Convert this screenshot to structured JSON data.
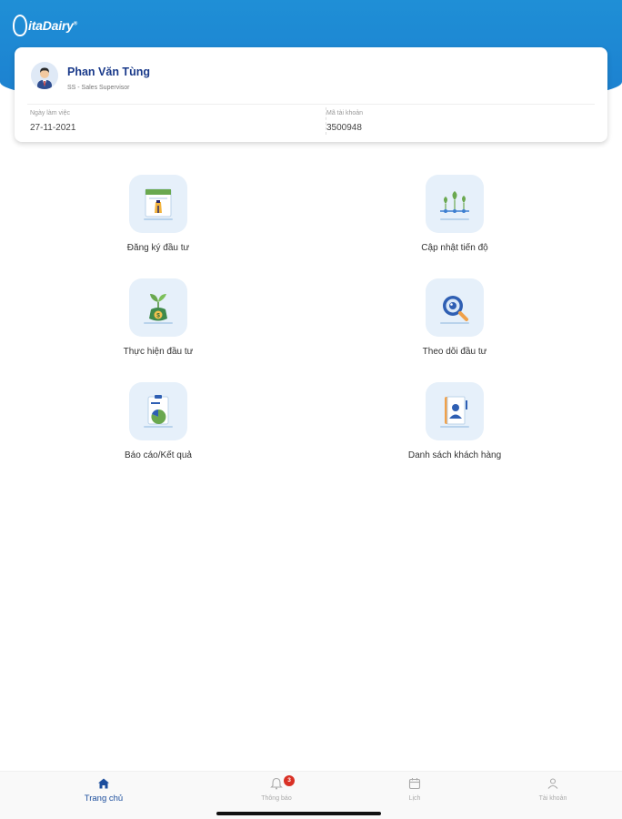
{
  "brand": {
    "logo_text": "itaDairy",
    "tm": "®",
    "primary_color": "#1f8fd6",
    "accent_color": "#1c4e9d"
  },
  "profile": {
    "name": "Phan Văn Tùng",
    "role": "SS - Sales Supervisor",
    "work_date_label": "Ngày làm việc",
    "work_date_value": "27-11-2021",
    "account_label": "Mã tài khoản",
    "account_value": "3500948"
  },
  "menu": [
    {
      "label": "Đăng ký đầu tư",
      "icon": "investment-register-icon"
    },
    {
      "label": "Cập nhật tiến độ",
      "icon": "progress-update-icon"
    },
    {
      "label": "Thực hiện đầu tư",
      "icon": "money-plant-icon"
    },
    {
      "label": "Theo dõi đầu tư",
      "icon": "magnifier-icon"
    },
    {
      "label": "Báo cáo/Kết quả",
      "icon": "report-icon"
    },
    {
      "label": "Danh sách khách hàng",
      "icon": "contact-book-icon"
    }
  ],
  "nav": [
    {
      "label": "Trang chủ",
      "icon": "home-icon",
      "active": true
    },
    {
      "label": "Thông báo",
      "icon": "bell-icon",
      "badge": "3"
    },
    {
      "label": "Lịch",
      "icon": "calendar-icon"
    },
    {
      "label": "Tài khoản",
      "icon": "user-icon"
    }
  ]
}
